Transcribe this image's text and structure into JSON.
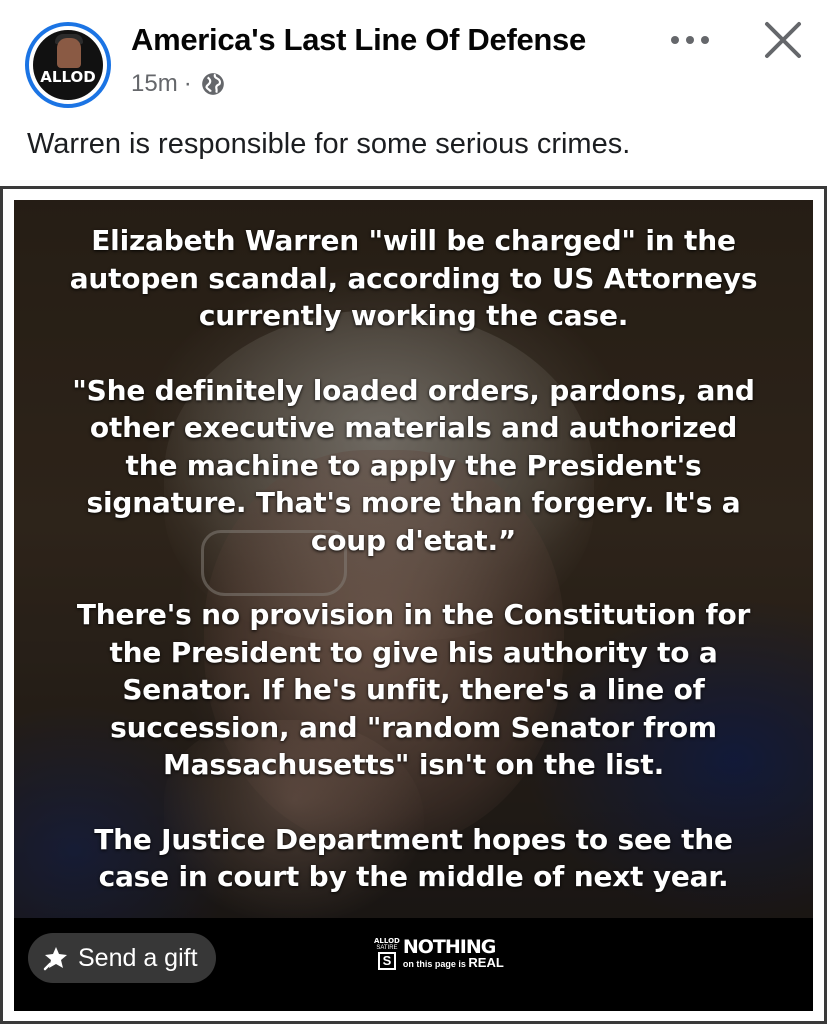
{
  "post": {
    "page_name": "America's Last Line Of Defense",
    "time": "15m",
    "separator": "·",
    "privacy_icon": "globe-icon",
    "avatar_text": "ALLOD",
    "caption": "Warren is responsible for some serious crimes."
  },
  "header_actions": {
    "more_icon": "more-horizontal-icon",
    "close_icon": "close-icon"
  },
  "image": {
    "paragraphs": [
      "Elizabeth Warren \"will be charged\" in the\nautopen scandal, according to US Attorneys\ncurrently working the case.",
      "\"She definitely loaded orders, pardons, and\nother executive materials and authorized\nthe machine to apply the President's\nsignature. That's more than forgery. It's a\ncoup d'etat.”",
      "There's no provision in the Constitution for\nthe President to give his authority to a\nSenator. If he's unfit, there's a line of\nsuccession, and \"random Senator from\nMassachusetts\" isn't on the list.",
      "The Justice Department hopes to see the\ncase in court by the middle of next year."
    ],
    "watermark": {
      "allod": "ALLOD",
      "satire": "SATIRE",
      "s": "S",
      "nothing": "NOTHING",
      "sub_prefix": "on this page is",
      "sub_real": "REAL"
    }
  },
  "gift_button": {
    "label": "Send a gift",
    "icon": "gift-sparkle-icon"
  },
  "colors": {
    "accent": "#1b74e4",
    "text": "#1c1e21",
    "secondary": "#65676b"
  }
}
